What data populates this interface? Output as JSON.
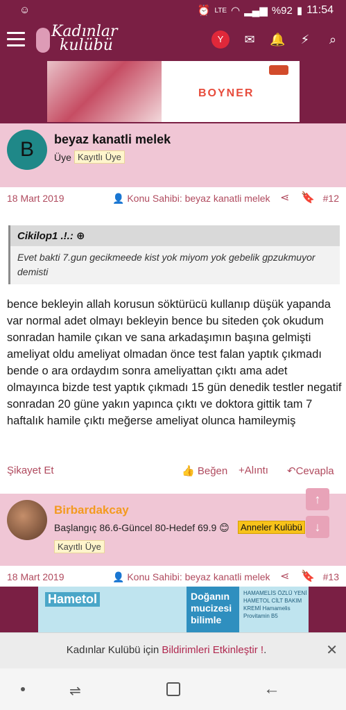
{
  "status_bar": {
    "battery": "%92",
    "time": "11:54",
    "network": "LTE"
  },
  "header": {
    "logo_line1": "Kadınlar",
    "logo_line2": "kulübü",
    "avatar_letter": "Y"
  },
  "ads": {
    "top_brand": "BOYNER",
    "bottom_brand": "Hametol",
    "bottom_tagline": "Doğanın mucizesi bilimle",
    "bottom_side": "HAMAMELİS ÖZLÜ YENİ HAMETOL CİLT BAKIM KREMİ Hamamelis Provitamin B5"
  },
  "post1": {
    "avatar_letter": "B",
    "username": "beyaz kanatli melek",
    "role": "Üye",
    "badge": "Kayıtlı Üye",
    "date": "18 Mart 2019",
    "owner": "Konu Sahibi: beyaz kanatli melek",
    "number": "#12",
    "quote_author": "Cikilop1 .!.:",
    "quote_text": "Evet bakti 7.gun gecikmeede kist yok miyom yok gebelik gpzukmuyor demisti",
    "body": "bence bekleyin allah korusun söktürücü kullanıp düşük yapanda var normal adet olmayı bekleyin bence bu siteden çok okudum sonradan hamile çıkan ve sana arkadaşımın başına gelmişti ameliyat oldu ameliyat olmadan önce test falan yaptık çıkmadı bende o ara ordaydım sonra ameliyattan çıktı ama adet olmayınca bizde test yaptık çıkmadı 15 gün denedik testler negatif sonradan 20 güne yakın yapınca çıktı ve doktora gittik tam 7 haftalık hamile çıktı meğerse ameliyat olunca hamileymiş",
    "report_label": "Şikayet Et",
    "like_label": "Beğen",
    "quote_label": "Alıntı",
    "reply_label": "Cevapla"
  },
  "post2": {
    "username": "Birbardakcay",
    "info": "Başlangıç 86.6-Güncel 80-Hedef 69.9 😊",
    "group_badge": "Anneler Kulübü",
    "badge": "Kayıtlı Üye",
    "date": "18 Mart 2019",
    "owner": "Konu Sahibi: beyaz kanatli melek",
    "number": "#13"
  },
  "notification": {
    "prefix": "Kadınlar Kulübü için ",
    "link": "Bildirimleri Etkinleştir !",
    "suffix": "."
  },
  "colors": {
    "brand": "#7a1f44",
    "card_pink": "#f0c6d5",
    "accent": "#b04a5e",
    "orange": "#f39a1f"
  }
}
